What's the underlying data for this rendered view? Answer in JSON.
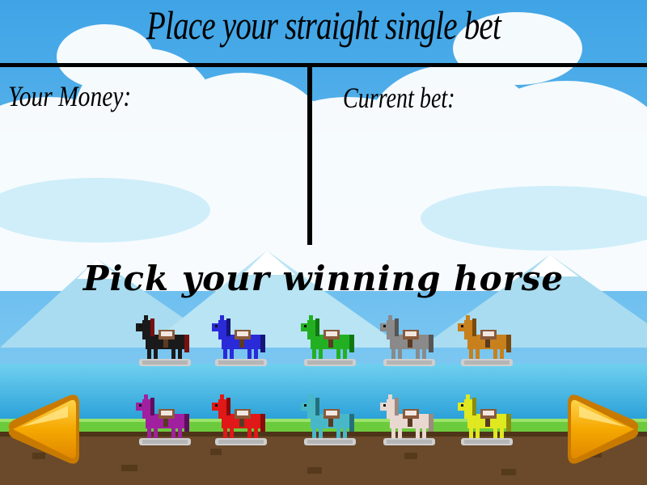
{
  "header": {
    "title": "Place your straight single bet"
  },
  "panels": {
    "money_label": "Your Money:",
    "money_value": "",
    "bet_label": "Current bet:",
    "bet_value": ""
  },
  "prompt": "Pick your winning horse",
  "horses": [
    {
      "row": 1,
      "col": 1,
      "color": "#1a1a1a",
      "mane": "#7a1010"
    },
    {
      "row": 1,
      "col": 2,
      "color": "#2a2ad8",
      "mane": "#15157a"
    },
    {
      "row": 1,
      "col": 3,
      "color": "#22b022",
      "mane": "#117711"
    },
    {
      "row": 1,
      "col": 4,
      "color": "#8a8a8a",
      "mane": "#555555"
    },
    {
      "row": 1,
      "col": 5,
      "color": "#c8801c",
      "mane": "#7a4a0e"
    },
    {
      "row": 2,
      "col": 1,
      "color": "#a020a0",
      "mane": "#5e0e5e"
    },
    {
      "row": 2,
      "col": 2,
      "color": "#e01818",
      "mane": "#8a0a0a"
    },
    {
      "row": 2,
      "col": 3,
      "color": "#48b8c8",
      "mane": "#24707a"
    },
    {
      "row": 2,
      "col": 4,
      "color": "#e8d8d0",
      "mane": "#9a8a80"
    },
    {
      "row": 2,
      "col": 5,
      "color": "#e0e820",
      "mane": "#8a8c10"
    }
  ],
  "navigation": {
    "left": "left-arrow",
    "right": "right-arrow"
  },
  "colors": {
    "sky": "#4aaee8",
    "grass": "#6ccb3c",
    "dirt": "#6a4a2a",
    "arrow": "#f5a800"
  }
}
